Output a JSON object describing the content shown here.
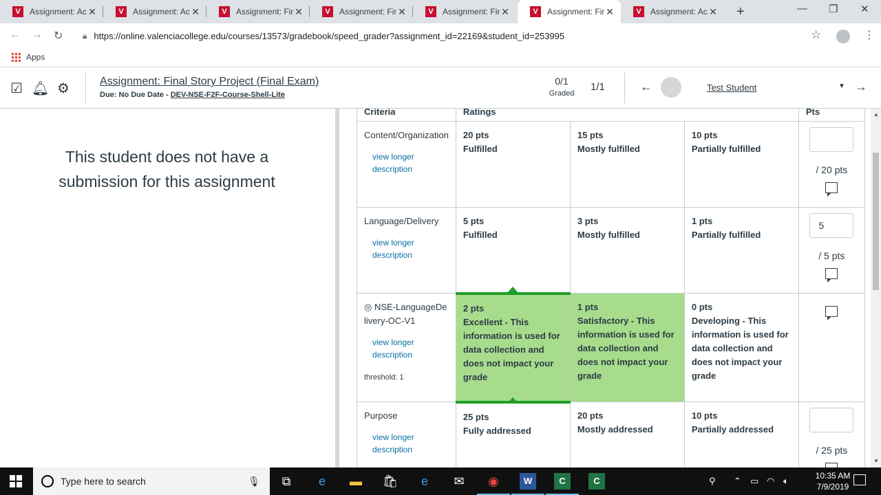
{
  "browser": {
    "tabs": [
      {
        "title": "Assignment: Ac",
        "active": false
      },
      {
        "title": "Assignment: Ac",
        "active": false
      },
      {
        "title": "Assignment: Fin",
        "active": false
      },
      {
        "title": "Assignment: Fin",
        "active": false
      },
      {
        "title": "Assignment: Fin",
        "active": false
      },
      {
        "title": "Assignment: Fin",
        "active": true
      },
      {
        "title": "Assignment: Ac",
        "active": false
      }
    ],
    "favicon_letter": "V",
    "url": "https://online.valenciacollege.edu/courses/13573/gradebook/speed_grader?assignment_id=22169&student_id=253995",
    "bookmarks": {
      "apps_label": "Apps"
    }
  },
  "header": {
    "assignment_title": "Assignment: Final Story Project (Final Exam)",
    "due_text": "Due: No Due Date - ",
    "course_link": "DEV-NSE-F2F-Course-Shell-Lite",
    "graded_count": "0/1",
    "graded_label": "Graded",
    "position": "1/1",
    "student_name": "Test Student"
  },
  "left_panel": {
    "message": "This student does not have a submission for this assignment"
  },
  "rubric": {
    "headers": {
      "criteria": "Criteria",
      "ratings": "Ratings",
      "pts": "Pts"
    },
    "view_longer": "view longer description",
    "rows": [
      {
        "criterion": "Content/Organization",
        "ratings": [
          {
            "pts": "20 pts",
            "desc": "Fulfilled"
          },
          {
            "pts": "15 pts",
            "desc": "Mostly fulfilled"
          },
          {
            "pts": "10 pts",
            "desc": "Partially fulfilled"
          }
        ],
        "score": "",
        "out_of": "/ 20 pts"
      },
      {
        "criterion": "Language/Delivery",
        "ratings": [
          {
            "pts": "5 pts",
            "desc": "Fulfilled"
          },
          {
            "pts": "3 pts",
            "desc": "Mostly fulfilled"
          },
          {
            "pts": "1 pts",
            "desc": "Partially fulfilled"
          }
        ],
        "score": "5",
        "out_of": "/ 5 pts"
      },
      {
        "criterion": "NSE-LanguageDelivery-OC-V1",
        "threshold": "threshold: 1",
        "ratings": [
          {
            "pts": "2 pts",
            "desc": "Excellent - This information is used for data collection and does not impact your grade"
          },
          {
            "pts": "1 pts",
            "desc": "Satisfactory - This information is used for data collection and does not impact your grade"
          },
          {
            "pts": "0 pts",
            "desc": "Developing - This information is used for data collection and does not impact your grade"
          }
        ]
      },
      {
        "criterion": "Purpose",
        "ratings": [
          {
            "pts": "25 pts",
            "desc": "Fully addressed"
          },
          {
            "pts": "20 pts",
            "desc": "Mostly addressed"
          },
          {
            "pts": "10 pts",
            "desc": "Partially addressed"
          }
        ],
        "score": "",
        "out_of": "/ 25 pts"
      }
    ]
  },
  "taskbar": {
    "search_placeholder": "Type here to search",
    "time": "10:35 AM",
    "date": "7/9/2019"
  },
  "colors": {
    "selected_rating": "#a6dc8c",
    "selected_border": "#1f9e27",
    "link": "#0770a3",
    "favicon": "#c8102e"
  }
}
